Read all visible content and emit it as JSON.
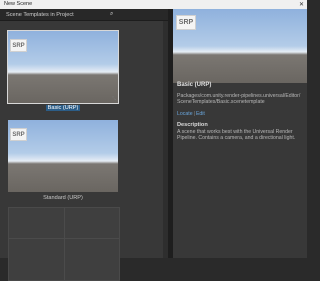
{
  "window": {
    "title": "New Scene",
    "close_glyph": "✕"
  },
  "left_panel": {
    "header": "Scene Templates in Project",
    "search_icon": "search-icon",
    "templates": [
      {
        "label": "Basic (URP)",
        "badge": "SRP",
        "selected": true
      },
      {
        "label": "Standard (URP)",
        "badge": "SRP",
        "selected": false
      }
    ]
  },
  "details": {
    "badge": "SRP",
    "name": "Basic (URP)",
    "path": "Packages/com.unity.render-pipelines.universal/Editor/SceneTemplates/Basic.scenetemplate",
    "links": {
      "locate": "Locate",
      "separator": "|",
      "edit": "Edit"
    },
    "description_heading": "Description",
    "description": "A scene that works best with the Universal Render Pipeline. Contains a camera, and a directional light."
  },
  "colors": {
    "selection": "#2c5d87",
    "link": "#6aa6dc",
    "panel_bg": "#383838"
  }
}
